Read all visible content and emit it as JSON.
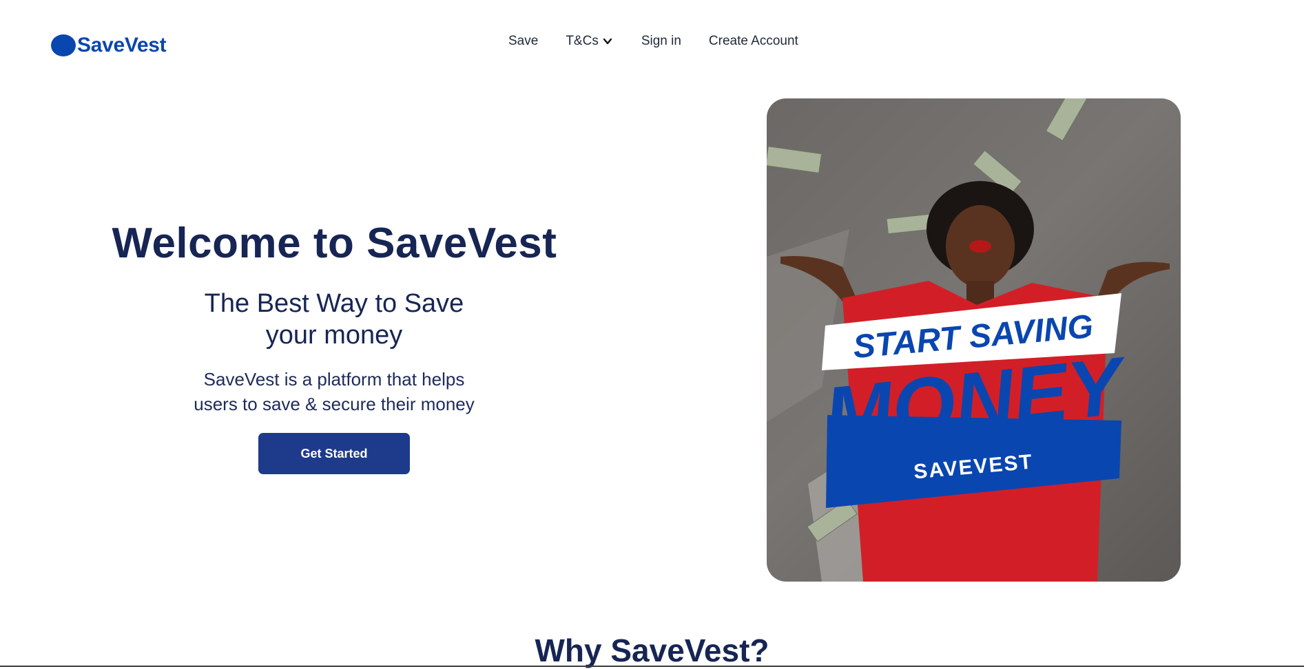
{
  "brand": {
    "name": "SaveVest",
    "color": "#0a46b0"
  },
  "nav": {
    "items": [
      {
        "label": "Save"
      },
      {
        "label": "T&Cs"
      },
      {
        "label": "Sign in"
      },
      {
        "label": "Create Account"
      }
    ]
  },
  "hero": {
    "title": "Welcome to SaveVest",
    "subtitle_line1": "The Best Way to Save",
    "subtitle_line2": "your money",
    "description_line1": "SaveVest is a platform that helps",
    "description_line2": "users to save & secure their money",
    "cta_label": "Get Started",
    "cta_color": "#1e3a8a"
  },
  "promo_image": {
    "banner_top": "START SAVING",
    "banner_main": "MONEY",
    "banner_bottom": "SAVEVEST"
  },
  "sections": {
    "why_title": "Why SaveVest?"
  }
}
